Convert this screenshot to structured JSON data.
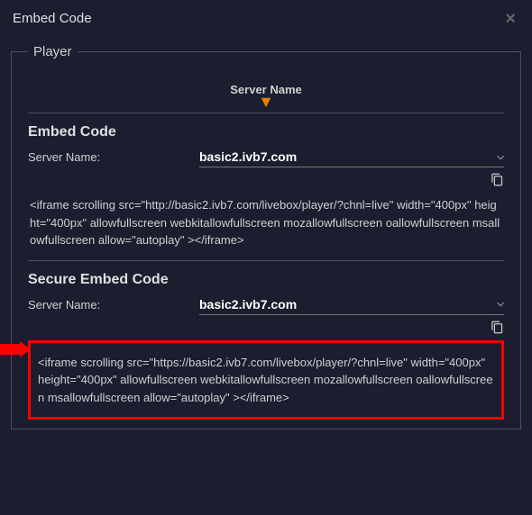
{
  "modal": {
    "title": "Embed Code"
  },
  "fieldset": {
    "legend": "Player"
  },
  "header": {
    "server_name_label": "Server Name"
  },
  "section1": {
    "title": "Embed Code",
    "server_label": "Server Name:",
    "server_value": "basic2.ivb7.com",
    "code": "<iframe scrolling src=\"http://basic2.ivb7.com/livebox/player/?chnl=live\" width=\"400px\" height=\"400px\" allowfullscreen webkitallowfullscreen mozallowfullscreen oallowfullscreen msallowfullscreen allow=\"autoplay\" ></iframe>"
  },
  "section2": {
    "title": "Secure Embed Code",
    "server_label": "Server Name:",
    "server_value": "basic2.ivb7.com",
    "code": "<iframe scrolling src=\"https://basic2.ivb7.com/livebox/player/?chnl=live\" width=\"400px\" height=\"400px\" allowfullscreen webkitallowfullscreen mozallowfullscreen oallowfullscreen msallowfullscreen allow=\"autoplay\" ></iframe>"
  }
}
